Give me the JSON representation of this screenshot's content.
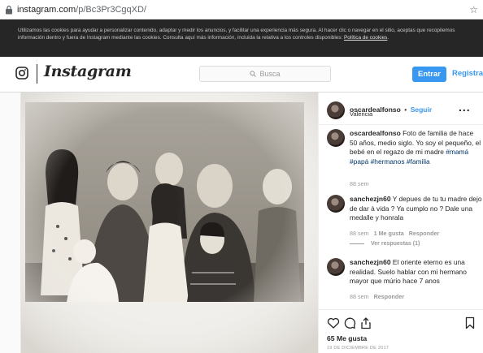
{
  "browser": {
    "url_host": "instagram.com",
    "url_path": "/p/Bc3Pr3CgqXD/"
  },
  "cookie_banner": {
    "text": "Utilizamos las cookies para ayudar a personalizar contenido, adaptar y medir los anuncios, y facilitar una experiencia más segura. Al hacer clic o navegar en el sitio, aceptas que recopilemos información dentro y fuera de Instagram mediante las cookies. Consulta aquí más información, incluida la relativa a los controles disponibles: ",
    "link_text": "Política de cookies",
    "end": "."
  },
  "header": {
    "logo_text": "Instagram",
    "search_placeholder": "Busca",
    "login_label": "Entrar",
    "signup_label": "Registrar"
  },
  "post": {
    "username": "oscardealfonso",
    "separator": "•",
    "follow_label": "Seguir",
    "location": "Valencia",
    "more_label": "...",
    "caption": {
      "username": "oscardealfonso",
      "text": "Foto de familia de hace 50 años, medio siglo. Yo soy el pequeño, el bebé en el regazo de mi madre",
      "hashtags": [
        "#mamá",
        "#papá",
        "#hermanos",
        "#familia"
      ],
      "time": "88 sem"
    },
    "comments": [
      {
        "username": "sanchezjn60",
        "text": "Y depues de tu tu madre dejo de dar à vida ? Ya cumplo no ? Dale una medalle y honrala",
        "time": "88 sem",
        "likes": "1 Me gusta",
        "reply_label": "Responder",
        "view_replies": "Ver respuestas (1)"
      },
      {
        "username": "sanchezjn60",
        "text": "El oriente eterno es una realidad. Suelo hablar con mi hermano mayor que múrio hace 7 anos",
        "time": "88 sem",
        "reply_label": "Responder"
      }
    ],
    "likes": "65 Me gusta",
    "date": "19 DE DICIEMBRE DE 2017"
  },
  "icons": {
    "lock": "lock-icon",
    "star": "star-icon",
    "camera": "instagram-camera-icon",
    "search": "search-icon",
    "heart": "heart-icon",
    "comment": "comment-icon",
    "share": "share-icon",
    "bookmark": "bookmark-icon"
  },
  "colors": {
    "accent": "#3897f0",
    "hashtag": "#003569",
    "muted": "#999999",
    "banner": "#262626"
  }
}
